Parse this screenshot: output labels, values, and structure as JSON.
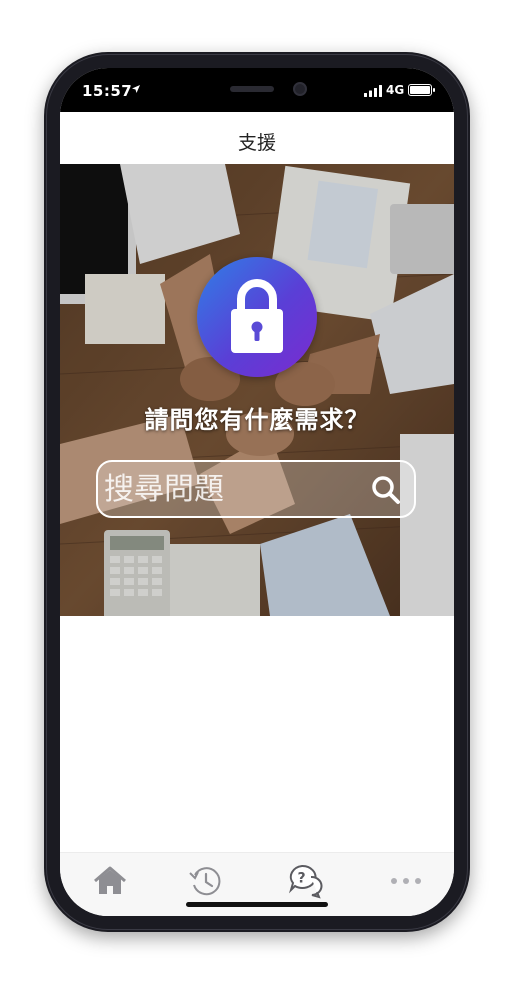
{
  "status_bar": {
    "time": "15:57",
    "network": "4G"
  },
  "header": {
    "title": "支援"
  },
  "hero": {
    "question": "請問您有什麼需求？",
    "search": {
      "placeholder": "搜尋問題"
    },
    "lock_gradient": [
      "#2f7fe6",
      "#7b2bd0"
    ]
  },
  "tab_bar": {
    "items": [
      {
        "icon": "home-icon",
        "active": true
      },
      {
        "icon": "history-icon",
        "active": false
      },
      {
        "icon": "help-chat-icon",
        "active": false
      },
      {
        "icon": "more-icon",
        "active": false
      }
    ]
  },
  "colors": {
    "tab_icon": "#8e8e93",
    "frame": "#1b1b22"
  }
}
